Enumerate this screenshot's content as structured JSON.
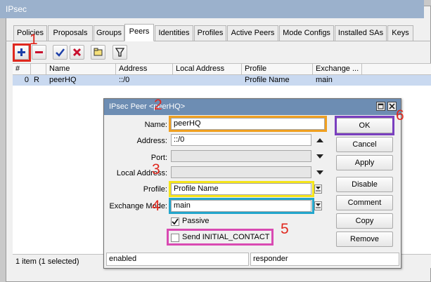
{
  "window": {
    "title": "IPsec"
  },
  "tabs": [
    "Policies",
    "Proposals",
    "Groups",
    "Peers",
    "Identities",
    "Profiles",
    "Active Peers",
    "Mode Configs",
    "Installed SAs",
    "Keys"
  ],
  "active_tab": "Peers",
  "toolbar": {
    "icons": [
      "add-icon",
      "remove-icon",
      "enable-check-icon",
      "disable-x-icon",
      "comment-icon",
      "filter-icon"
    ]
  },
  "table": {
    "columns": [
      "#",
      "Name",
      "Address",
      "Local Address",
      "Profile",
      "Exchange ..."
    ],
    "rows": [
      {
        "num": "0",
        "flag": "R",
        "name": "peerHQ",
        "address": "::/0",
        "local_address": "",
        "profile": "Profile Name",
        "exchange": "main"
      }
    ]
  },
  "status": {
    "items": "1 item (1 selected)"
  },
  "dialog": {
    "title": "IPsec Peer <peerHQ>",
    "fields": {
      "name": {
        "label": "Name:",
        "value": "peerHQ"
      },
      "address": {
        "label": "Address:",
        "value": "::/0"
      },
      "port": {
        "label": "Port:",
        "value": ""
      },
      "local_address": {
        "label": "Local Address:",
        "value": ""
      },
      "profile": {
        "label": "Profile:",
        "value": "Profile Name"
      },
      "exchange_mode": {
        "label": "Exchange Mode:",
        "value": "main"
      }
    },
    "passive": {
      "label": "Passive",
      "checked": true
    },
    "send_initial_contact": {
      "label": "Send INITIAL_CONTACT",
      "checked": false
    },
    "buttons": [
      "OK",
      "Cancel",
      "Apply",
      "Disable",
      "Comment",
      "Copy",
      "Remove"
    ],
    "status_left": "enabled",
    "status_right": "responder"
  },
  "annotations": [
    "1",
    "2",
    "3",
    "4",
    "5",
    "6"
  ],
  "colors": {
    "highlight_red": "#e0281e",
    "highlight_orange": "#f0a020",
    "highlight_yellow": "#f5e51a",
    "highlight_cyan": "#23a6cc",
    "highlight_magenta": "#d94ab2",
    "highlight_purple": "#7a3fbf",
    "selection": "#c9d9f0",
    "title_blue": "#6d8db3"
  }
}
